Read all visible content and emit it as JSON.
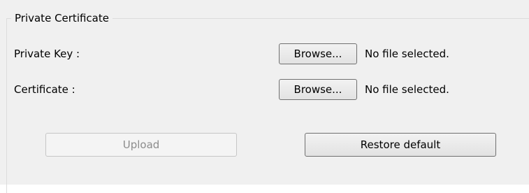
{
  "group": {
    "title": "Private Certificate"
  },
  "private_key": {
    "label": "Private Key :",
    "browse_label": "Browse...",
    "status": "No file selected."
  },
  "certificate": {
    "label": "Certificate :",
    "browse_label": "Browse...",
    "status": "No file selected."
  },
  "actions": {
    "upload_label": "Upload",
    "upload_enabled": false,
    "restore_label": "Restore default"
  }
}
